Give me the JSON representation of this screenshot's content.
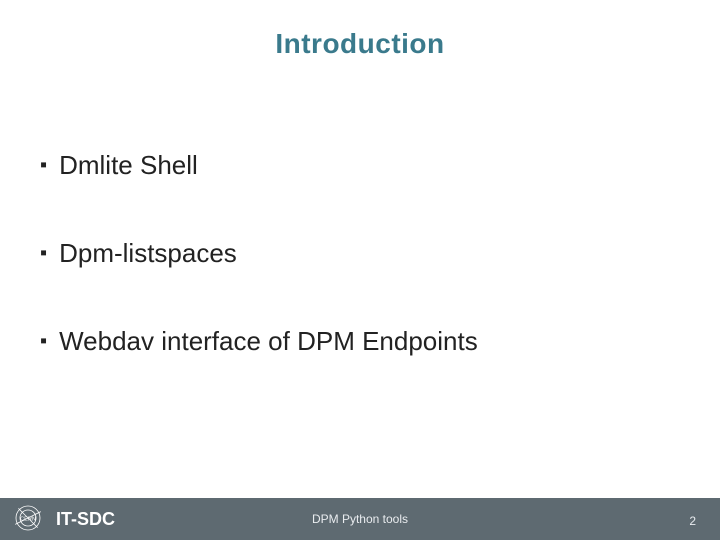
{
  "title": "Introduction",
  "bullets": [
    "Dmlite Shell",
    "Dpm-listspaces",
    "Webdav interface of DPM Endpoints"
  ],
  "brand": "IT-SDC",
  "footer_title": "DPM Python tools",
  "page_number": "2",
  "colors": {
    "title": "#3a7a8c",
    "footer_bg": "#5e6a71"
  }
}
